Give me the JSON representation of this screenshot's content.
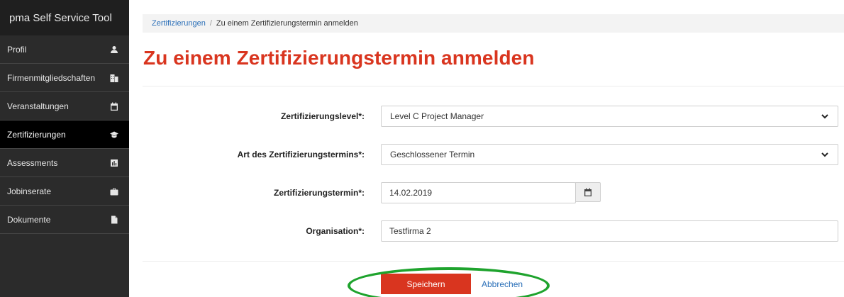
{
  "app": {
    "title": "pma Self Service Tool"
  },
  "sidebar": {
    "items": [
      {
        "label": "Profil",
        "icon": "user-icon",
        "active": false
      },
      {
        "label": "Firmenmitgliedschaften",
        "icon": "building-icon",
        "active": false
      },
      {
        "label": "Veranstaltungen",
        "icon": "calendar-icon",
        "active": false
      },
      {
        "label": "Zertifizierungen",
        "icon": "graduation-cap-icon",
        "active": true
      },
      {
        "label": "Assessments",
        "icon": "bar-chart-icon",
        "active": false
      },
      {
        "label": "Jobinserate",
        "icon": "briefcase-icon",
        "active": false
      },
      {
        "label": "Dokumente",
        "icon": "document-icon",
        "active": false
      }
    ]
  },
  "breadcrumb": {
    "parent": "Zertifizierungen",
    "separator": "/",
    "current": "Zu einem Zertifizierungstermin anmelden"
  },
  "page": {
    "title": "Zu einem Zertifizierungstermin anmelden"
  },
  "form": {
    "level": {
      "label": "Zertifizierungslevel*:",
      "value": "Level C Project Manager"
    },
    "type": {
      "label": "Art des Zertifizierungstermins*:",
      "value": "Geschlossener Termin"
    },
    "date": {
      "label": "Zertifizierungstermin*:",
      "value": "14.02.2019"
    },
    "organisation": {
      "label": "Organisation*:",
      "value": "Testfirma 2"
    }
  },
  "actions": {
    "save_label": "Speichern",
    "cancel_label": "Abbrechen"
  },
  "colors": {
    "accent": "#d9351f",
    "link": "#2a6fb8",
    "sidebar": "#2b2b2b",
    "highlight": "#1ea32d"
  }
}
